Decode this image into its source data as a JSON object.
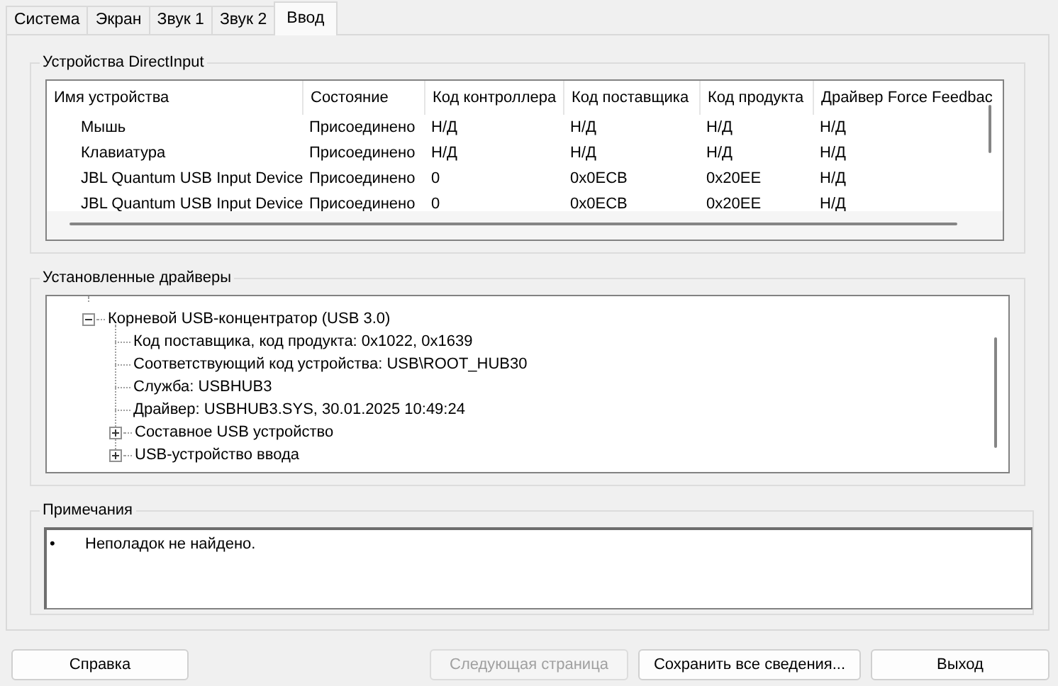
{
  "tabs": [
    {
      "label": "Система",
      "selected": false
    },
    {
      "label": "Экран",
      "selected": false
    },
    {
      "label": "Звук 1",
      "selected": false
    },
    {
      "label": "Звук 2",
      "selected": false
    },
    {
      "label": "Ввод",
      "selected": true
    }
  ],
  "devices": {
    "title": "Устройства DirectInput",
    "columns": [
      "Имя устройства",
      "Состояние",
      "Код контроллера",
      "Код поставщика",
      "Код продукта",
      "Драйвер Force Feedbac"
    ],
    "rows": [
      [
        "Мышь",
        "Присоединено",
        "Н/Д",
        "Н/Д",
        "Н/Д",
        "Н/Д"
      ],
      [
        "Клавиатура",
        "Присоединено",
        "Н/Д",
        "Н/Д",
        "Н/Д",
        "Н/Д"
      ],
      [
        "JBL Quantum USB Input Device",
        "Присоединено",
        "0",
        "0x0ECB",
        "0x20EE",
        "Н/Д"
      ],
      [
        "JBL Quantum USB Input Device",
        "Присоединено",
        "0",
        "0x0ECB",
        "0x20EE",
        "Н/Д"
      ]
    ]
  },
  "drivers": {
    "title": "Установленные драйверы",
    "tree": [
      {
        "label": "Корневой USB-концентратор (USB 3.0)",
        "expanded": true,
        "children": [
          {
            "label": "Код поставщика, код продукта: 0x1022, 0x1639"
          },
          {
            "label": "Соответствующий код устройства: USB\\ROOT_HUB30"
          },
          {
            "label": "Служба: USBHUB3"
          },
          {
            "label": "Драйвер: USBHUB3.SYS, 30.01.2025 10:49:24"
          },
          {
            "label": "Составное USB устройство",
            "expanded": false
          },
          {
            "label": "USB-устройство ввода",
            "expanded": false
          }
        ]
      }
    ]
  },
  "notes": {
    "title": "Примечания",
    "items": [
      {
        "bullet": "•",
        "text": "Неполадок не найдено."
      }
    ]
  },
  "buttons": [
    {
      "label": "Справка",
      "disabled": false
    },
    {
      "label": "Следующая страница",
      "disabled": true
    },
    {
      "label": "Сохранить все сведения...",
      "disabled": false
    },
    {
      "label": "Выход",
      "disabled": false
    }
  ]
}
